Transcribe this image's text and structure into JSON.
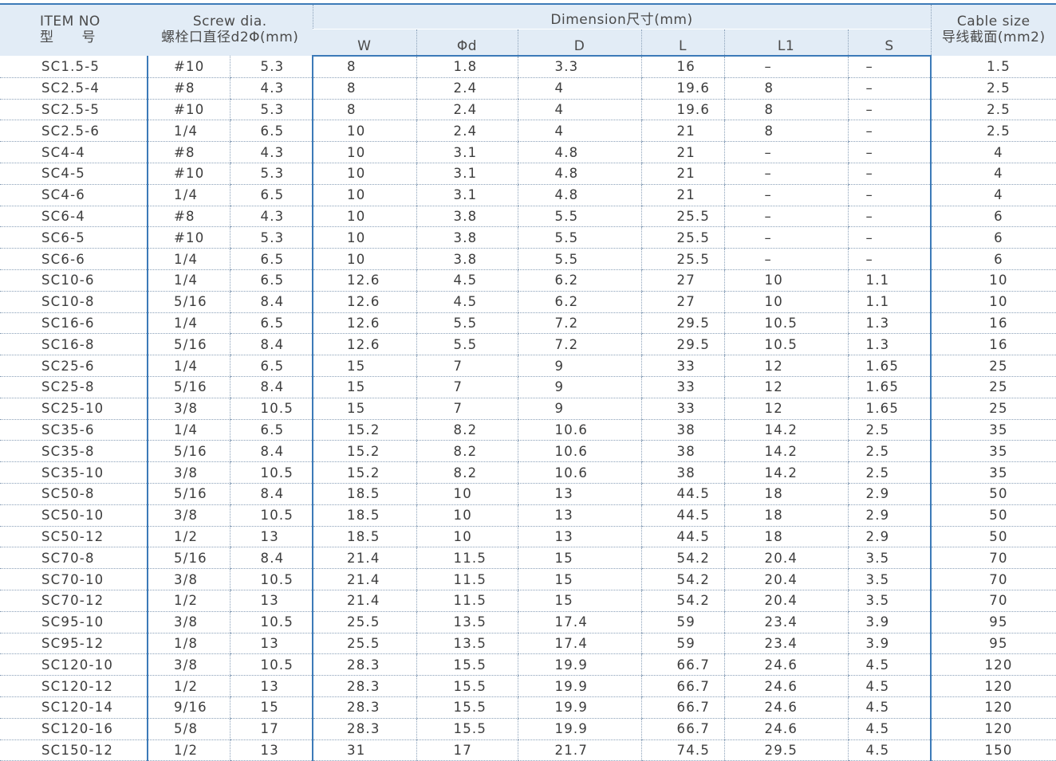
{
  "headers": {
    "item_no_en": "ITEM NO",
    "item_no_cn": "型　　号",
    "screw_en": "Screw dia.",
    "screw_cn": "螺栓口直径d2Φ(mm)",
    "dimension": "Dimension尺寸(mm)",
    "cable_en": "Cable size",
    "cable_cn": "导线截面(mm2)",
    "dim_cols": [
      "W",
      "Φd",
      "D",
      "L",
      "L1",
      "S"
    ]
  },
  "rows": [
    [
      "SC1.5-5",
      "#10",
      "5.3",
      "8",
      "1.8",
      "3.3",
      "16",
      "–",
      "–",
      "1.5"
    ],
    [
      "SC2.5-4",
      "#8",
      "4.3",
      "8",
      "2.4",
      "4",
      "19.6",
      "8",
      "–",
      "2.5"
    ],
    [
      "SC2.5-5",
      "#10",
      "5.3",
      "8",
      "2.4",
      "4",
      "19.6",
      "8",
      "–",
      "2.5"
    ],
    [
      "SC2.5-6",
      "1/4",
      "6.5",
      "10",
      "2.4",
      "4",
      "21",
      "8",
      "–",
      "2.5"
    ],
    [
      "SC4-4",
      "#8",
      "4.3",
      "10",
      "3.1",
      "4.8",
      "21",
      "–",
      "–",
      "4"
    ],
    [
      "SC4-5",
      "#10",
      "5.3",
      "10",
      "3.1",
      "4.8",
      "21",
      "–",
      "–",
      "4"
    ],
    [
      "SC4-6",
      "1/4",
      "6.5",
      "10",
      "3.1",
      "4.8",
      "21",
      "–",
      "–",
      "4"
    ],
    [
      "SC6-4",
      "#8",
      "4.3",
      "10",
      "3.8",
      "5.5",
      "25.5",
      "–",
      "–",
      "6"
    ],
    [
      "SC6-5",
      "#10",
      "5.3",
      "10",
      "3.8",
      "5.5",
      "25.5",
      "–",
      "–",
      "6"
    ],
    [
      "SC6-6",
      "1/4",
      "6.5",
      "10",
      "3.8",
      "5.5",
      "25.5",
      "–",
      "–",
      "6"
    ],
    [
      "SC10-6",
      "1/4",
      "6.5",
      "12.6",
      "4.5",
      "6.2",
      "27",
      "10",
      "1.1",
      "10"
    ],
    [
      "SC10-8",
      "5/16",
      "8.4",
      "12.6",
      "4.5",
      "6.2",
      "27",
      "10",
      "1.1",
      "10"
    ],
    [
      "SC16-6",
      "1/4",
      "6.5",
      "12.6",
      "5.5",
      "7.2",
      "29.5",
      "10.5",
      "1.3",
      "16"
    ],
    [
      "SC16-8",
      "5/16",
      "8.4",
      "12.6",
      "5.5",
      "7.2",
      "29.5",
      "10.5",
      "1.3",
      "16"
    ],
    [
      "SC25-6",
      "1/4",
      "6.5",
      "15",
      "7",
      "9",
      "33",
      "12",
      "1.65",
      "25"
    ],
    [
      "SC25-8",
      "5/16",
      "8.4",
      "15",
      "7",
      "9",
      "33",
      "12",
      "1.65",
      "25"
    ],
    [
      "SC25-10",
      "3/8",
      "10.5",
      "15",
      "7",
      "9",
      "33",
      "12",
      "1.65",
      "25"
    ],
    [
      "SC35-6",
      "1/4",
      "6.5",
      "15.2",
      "8.2",
      "10.6",
      "38",
      "14.2",
      "2.5",
      "35"
    ],
    [
      "SC35-8",
      "5/16",
      "8.4",
      "15.2",
      "8.2",
      "10.6",
      "38",
      "14.2",
      "2.5",
      "35"
    ],
    [
      "SC35-10",
      "3/8",
      "10.5",
      "15.2",
      "8.2",
      "10.6",
      "38",
      "14.2",
      "2.5",
      "35"
    ],
    [
      "SC50-8",
      "5/16",
      "8.4",
      "18.5",
      "10",
      "13",
      "44.5",
      "18",
      "2.9",
      "50"
    ],
    [
      "SC50-10",
      "3/8",
      "10.5",
      "18.5",
      "10",
      "13",
      "44.5",
      "18",
      "2.9",
      "50"
    ],
    [
      "SC50-12",
      "1/2",
      "13",
      "18.5",
      "10",
      "13",
      "44.5",
      "18",
      "2.9",
      "50"
    ],
    [
      "SC70-8",
      "5/16",
      "8.4",
      "21.4",
      "11.5",
      "15",
      "54.2",
      "20.4",
      "3.5",
      "70"
    ],
    [
      "SC70-10",
      "3/8",
      "10.5",
      "21.4",
      "11.5",
      "15",
      "54.2",
      "20.4",
      "3.5",
      "70"
    ],
    [
      "SC70-12",
      "1/2",
      "13",
      "21.4",
      "11.5",
      "15",
      "54.2",
      "20.4",
      "3.5",
      "70"
    ],
    [
      "SC95-10",
      "3/8",
      "10.5",
      "25.5",
      "13.5",
      "17.4",
      "59",
      "23.4",
      "3.9",
      "95"
    ],
    [
      "SC95-12",
      "1/8",
      "13",
      "25.5",
      "13.5",
      "17.4",
      "59",
      "23.4",
      "3.9",
      "95"
    ],
    [
      "SC120-10",
      "3/8",
      "10.5",
      "28.3",
      "15.5",
      "19.9",
      "66.7",
      "24.6",
      "4.5",
      "120"
    ],
    [
      "SC120-12",
      "1/2",
      "13",
      "28.3",
      "15.5",
      "19.9",
      "66.7",
      "24.6",
      "4.5",
      "120"
    ],
    [
      "SC120-14",
      "9/16",
      "15",
      "28.3",
      "15.5",
      "19.9",
      "66.7",
      "24.6",
      "4.5",
      "120"
    ],
    [
      "SC120-16",
      "5/8",
      "17",
      "28.3",
      "15.5",
      "19.9",
      "66.7",
      "24.6",
      "4.5",
      "120"
    ],
    [
      "SC150-12",
      "1/2",
      "13",
      "31",
      "17",
      "21.7",
      "74.5",
      "29.5",
      "4.5",
      "150"
    ]
  ]
}
